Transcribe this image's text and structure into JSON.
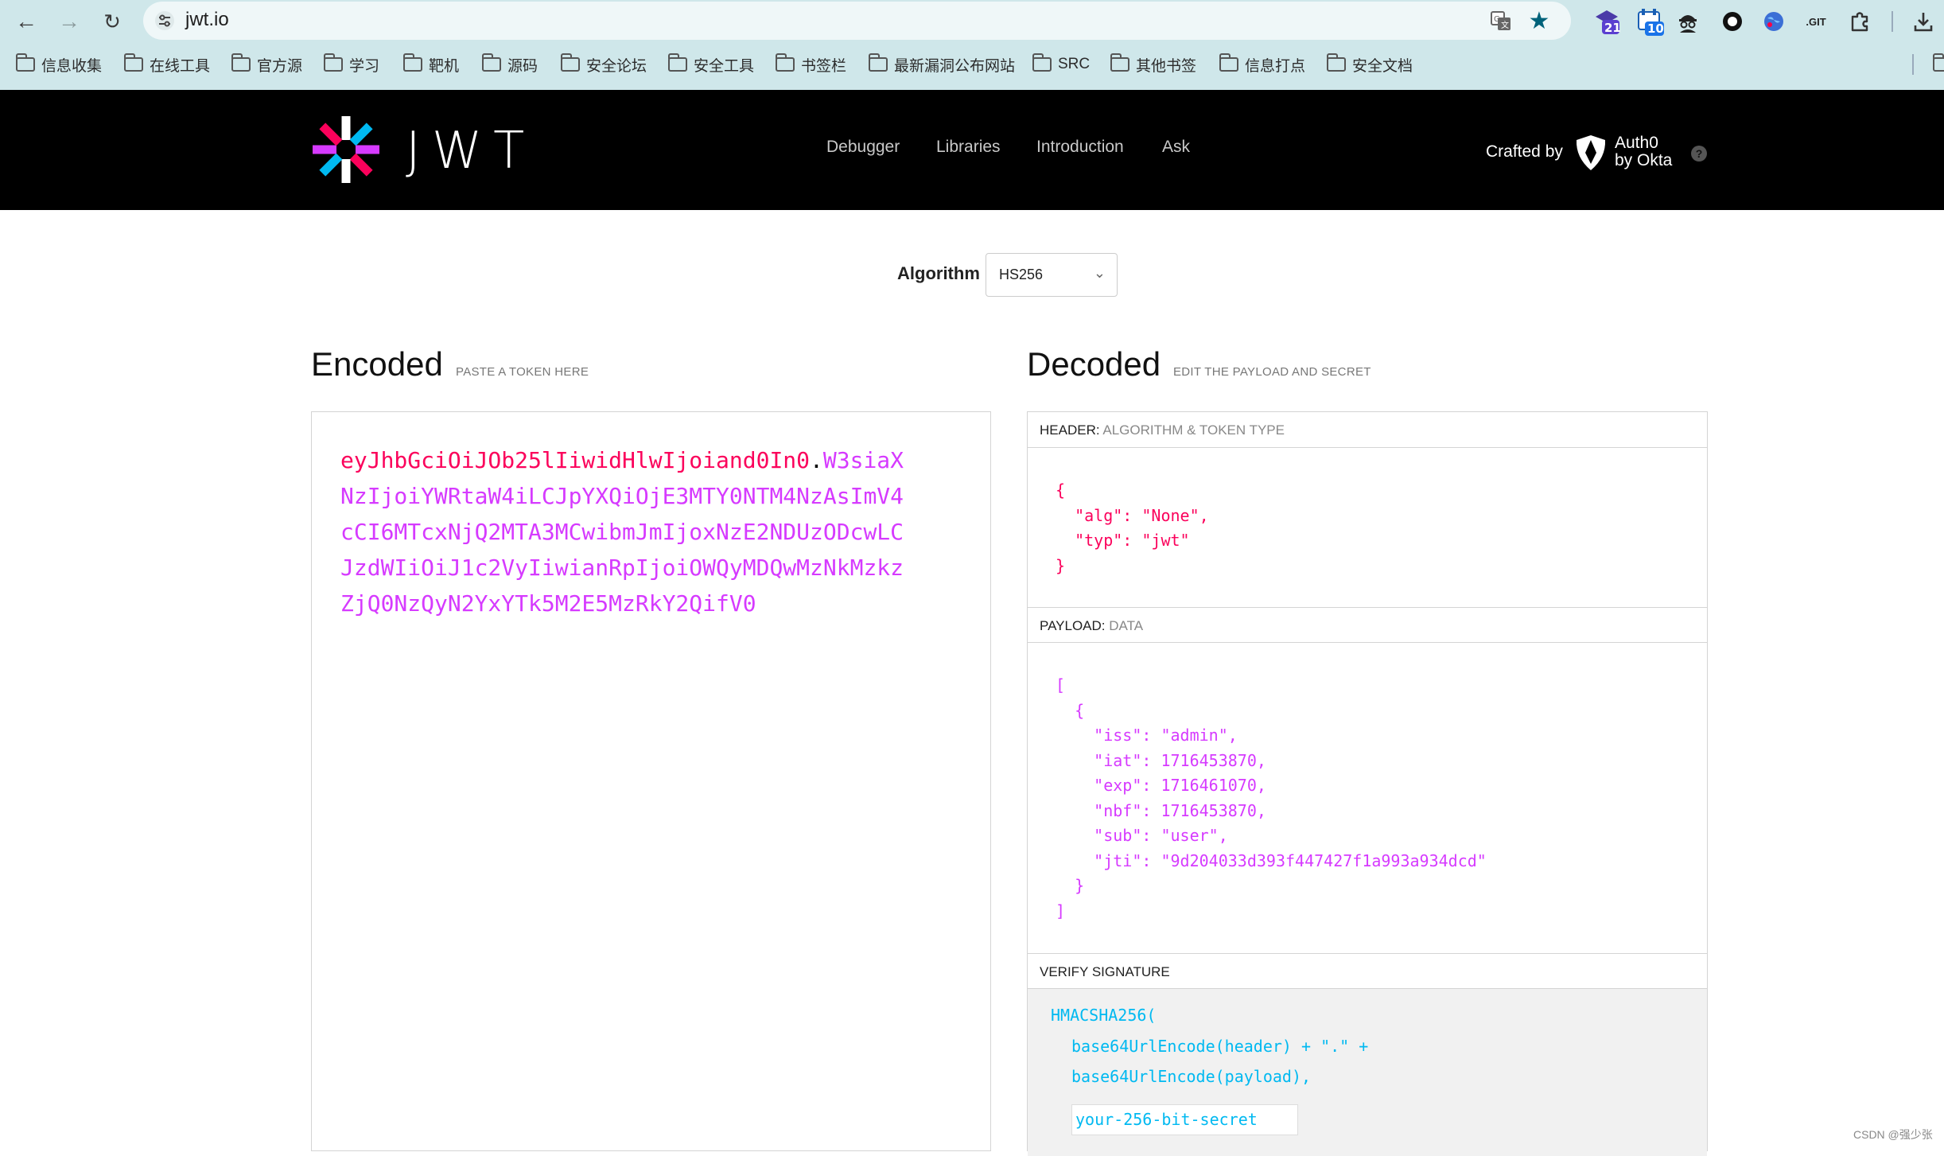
{
  "browser": {
    "url": "jwt.io",
    "extension_badges": [
      "21",
      "10"
    ],
    "ext_git_label": ".GIT",
    "bookmarks": [
      "信息收集",
      "在线工具",
      "官方源",
      "学习",
      "靶机",
      "源码",
      "安全论坛",
      "安全工具",
      "书签栏",
      "最新漏洞公布网站",
      "SRC",
      "其他书签",
      "信息打点",
      "安全文档"
    ]
  },
  "header": {
    "logo_text": "JWT",
    "nav": [
      "Debugger",
      "Libraries",
      "Introduction",
      "Ask"
    ],
    "crafted_by": "Crafted by",
    "auth0_line1": "Auth0",
    "auth0_line2": "by Okta",
    "help": "?"
  },
  "algorithm": {
    "label": "Algorithm",
    "value": "HS256"
  },
  "encoded": {
    "title": "Encoded",
    "subtitle": "PASTE A TOKEN HERE",
    "token_header": "eyJhbGciOiJOb25lIiwidHlwIjoiand0In0",
    "token_dot": ".",
    "token_payload": "W3siaXNzIjoiYWRtaW4iLCJpYXQiOjE3MTY0NTM4NzAsImV4cCI6MTcxNjQ2MTA3MCwibmJmIjoxNzE2NDUzODcwLCJzdWIiOiJ1c2VyIiwianRpIjoiOWQyMDQwMzNkMzkzZjQ0NzQyN2YxYTk5M2E5MzRkY2QifV0"
  },
  "decoded": {
    "title": "Decoded",
    "subtitle": "EDIT THE PAYLOAD AND SECRET",
    "header_label": "HEADER:",
    "header_sub": "ALGORITHM & TOKEN TYPE",
    "header_json": "{\n  \"alg\": \"None\",\n  \"typ\": \"jwt\"\n}",
    "payload_label": "PAYLOAD:",
    "payload_sub": "DATA",
    "payload_json": "[\n  {\n    \"iss\": \"admin\",\n    \"iat\": 1716453870,\n    \"exp\": 1716461070,\n    \"nbf\": 1716453870,\n    \"sub\": \"user\",\n    \"jti\": \"9d204033d393f447427f1a993a934dcd\"\n  }\n]",
    "verify_label": "VERIFY SIGNATURE",
    "sig_line1": "HMACSHA256(",
    "sig_line2": "base64UrlEncode(header) + \".\" +",
    "sig_line3": "base64UrlEncode(payload),",
    "secret_placeholder": "your-256-bit-secret"
  },
  "watermark": "CSDN @强少张"
}
